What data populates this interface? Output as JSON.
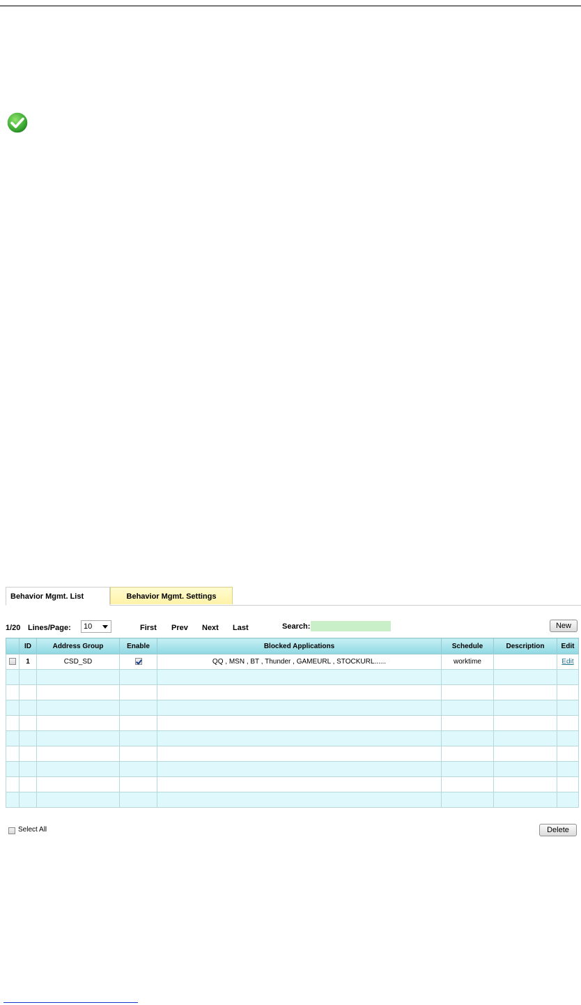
{
  "tabs": [
    {
      "label": "Behavior Mgmt. List",
      "active": true
    },
    {
      "label": "Behavior Mgmt. Settings",
      "active": false
    }
  ],
  "toolbar": {
    "page_info": "1/20",
    "lines_label": "Lines/Page:",
    "lines_value": "10",
    "first": "First",
    "prev": "Prev",
    "next": "Next",
    "last": "Last",
    "search_label": "Search:",
    "search_value": "",
    "new_label": "New"
  },
  "table": {
    "headers": [
      "",
      "ID",
      "Address Group",
      "Enable",
      "Blocked Applications",
      "Schedule",
      "Description",
      "Edit"
    ],
    "rows": [
      {
        "id": "1",
        "address_group": "CSD_SD",
        "enabled": true,
        "blocked_applications": "QQ , MSN , BT , Thunder , GAMEURL , STOCKURL......",
        "schedule": "worktime",
        "description": "",
        "edit": "Edit"
      }
    ],
    "empty_rows": 9
  },
  "footer": {
    "select_all_label": "Select All",
    "delete_label": "Delete"
  },
  "colors": {
    "header_bg": "#8fd8e2",
    "stripe_bg": "#def8fb",
    "search_bg": "#c9efc8",
    "tab_inactive_bg": "#fff3a8",
    "check_icon": "#3aa832"
  },
  "icons": {
    "status": "check-circle-icon"
  }
}
